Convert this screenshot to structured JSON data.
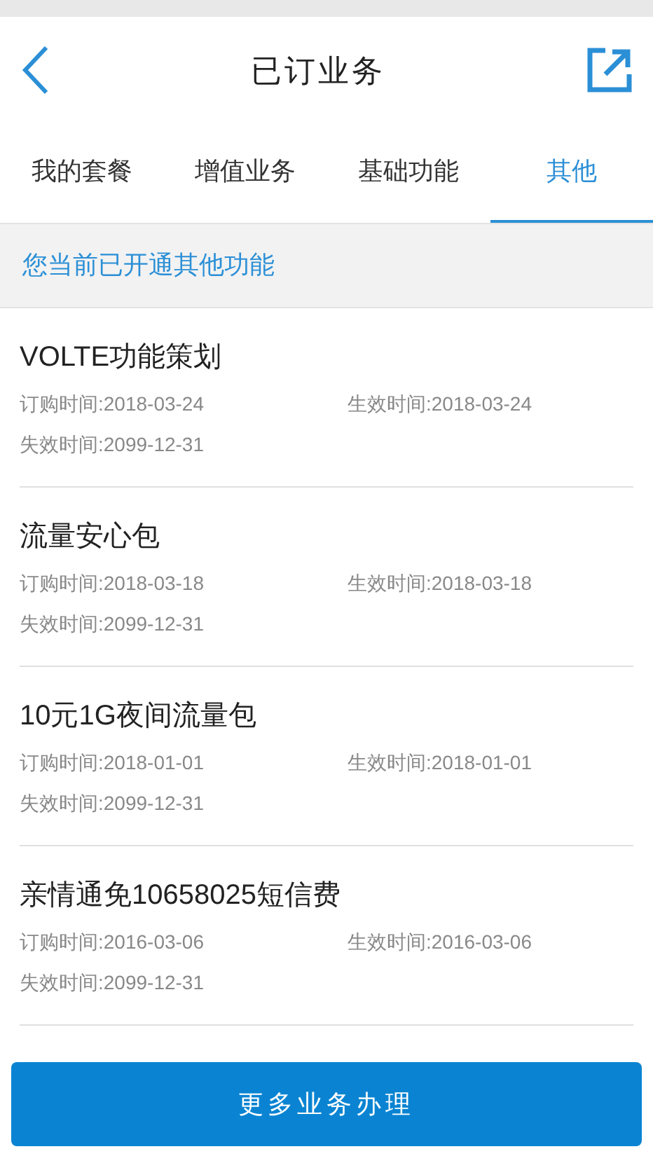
{
  "header": {
    "title": "已订业务"
  },
  "tabs": [
    {
      "label": "我的套餐",
      "selected": false
    },
    {
      "label": "增值业务",
      "selected": false
    },
    {
      "label": "基础功能",
      "selected": false
    },
    {
      "label": "其他",
      "selected": true
    }
  ],
  "section_title": "您当前已开通其他功能",
  "services": [
    {
      "name": "VOLTE功能策划",
      "ordered": "订购时间:2018-03-24",
      "effective": "生效时间:2018-03-24",
      "expires": "失效时间:2099-12-31"
    },
    {
      "name": "流量安心包",
      "ordered": "订购时间:2018-03-18",
      "effective": "生效时间:2018-03-18",
      "expires": "失效时间:2099-12-31"
    },
    {
      "name": "10元1G夜间流量包",
      "ordered": "订购时间:2018-01-01",
      "effective": "生效时间:2018-01-01",
      "expires": "失效时间:2099-12-31"
    },
    {
      "name": "亲情通免10658025短信费",
      "ordered": "订购时间:2016-03-06",
      "effective": "生效时间:2016-03-06",
      "expires": "失效时间:2099-12-31"
    }
  ],
  "action_button": "更多业务办理"
}
